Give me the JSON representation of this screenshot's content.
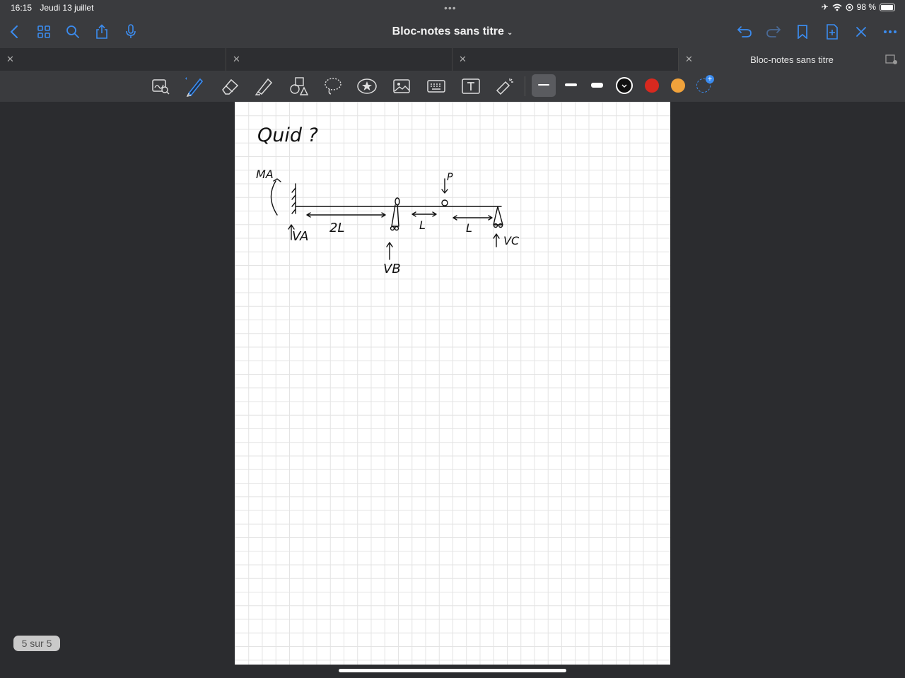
{
  "status": {
    "time": "16:15",
    "date": "Jeudi 13 juillet",
    "battery": "98 %"
  },
  "navbar": {
    "title": "Bloc-notes sans titre"
  },
  "tabs": [
    {
      "label": ""
    },
    {
      "label": ""
    },
    {
      "label": ""
    },
    {
      "label": "Bloc-notes sans titre"
    }
  ],
  "toolbar": {
    "tools": [
      "scan-doc-icon",
      "pen-icon",
      "eraser-icon",
      "highlighter-icon",
      "shapes-icon",
      "lasso-icon",
      "sticker-icon",
      "image-icon",
      "keyboard-icon",
      "text-box-icon",
      "laser-pointer-icon"
    ],
    "colors": {
      "black": "#111111",
      "red": "#d8291f",
      "orange": "#f0a23b",
      "accent": "#3b8cf0"
    }
  },
  "note": {
    "title_text": "Quid ?",
    "labels": {
      "MA": "MA",
      "VA": "VA",
      "VB": "VB",
      "VC": "VC",
      "P": "P",
      "seg1": "2L",
      "seg2": "L",
      "seg3": "L"
    }
  },
  "page_indicator": "5 sur 5"
}
